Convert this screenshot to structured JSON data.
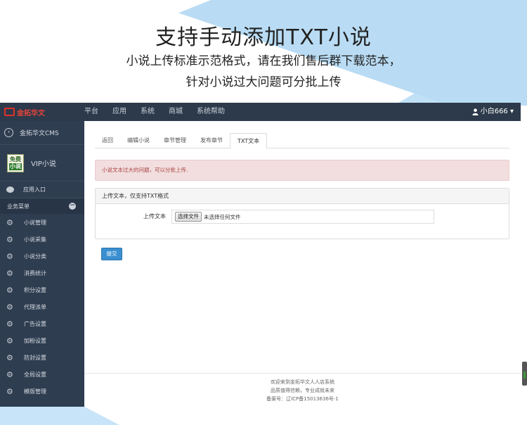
{
  "promo": {
    "title": "支持手动添加TXT小说",
    "line1": "小说上传标准示范格式，请在我们售后群下载范本，",
    "line2": "针对小说过大问题可分批上传"
  },
  "topbar": {
    "brand": "金拓华文",
    "nav": [
      "平台",
      "应用",
      "系统",
      "商城",
      "系统帮助"
    ],
    "user": "小白666 ▾"
  },
  "sidebar": {
    "back_label": "金拓华文CMS",
    "app_logo_top": "免费",
    "app_logo_bottom": "小说",
    "app_name": "VIP小说",
    "entry_label": "应用入口",
    "group_label": "业务菜单",
    "items": [
      {
        "label": "小说管理"
      },
      {
        "label": "小说采集"
      },
      {
        "label": "小说分类"
      },
      {
        "label": "消费统计"
      },
      {
        "label": "积分设置"
      },
      {
        "label": "代理派单"
      },
      {
        "label": "广告设置"
      },
      {
        "label": "加粉设置"
      },
      {
        "label": "防封设置"
      },
      {
        "label": "全局设置"
      },
      {
        "label": "模版管理"
      }
    ]
  },
  "main": {
    "tabs": [
      {
        "label": "返回"
      },
      {
        "label": "编辑小说"
      },
      {
        "label": "章节管理"
      },
      {
        "label": "发布章节"
      },
      {
        "label": "TXT文本"
      }
    ],
    "active_tab": "TXT文本",
    "alert": "小说文本过大的问题，可以分批上传.",
    "panel_heading": "上传文本，仅支持TXT格式",
    "form_label": "上传文本",
    "file_button": "选择文件",
    "file_status": "未选择任何文件",
    "submit_label": "提交",
    "footer": {
      "line1": "欢迎来到金拓华文人人店系统",
      "line2": "品质值得信赖，专业成就未来",
      "line3": "备案号：辽ICP备15013636号-1"
    }
  },
  "colors": {
    "topbar": "#2d3a4b",
    "sidebar": "#2f3d50",
    "alert_bg": "#f2dede",
    "alert_text": "#a94442",
    "primary_button": "#3a8fd0",
    "decor_blue": "#b9dcf4"
  }
}
